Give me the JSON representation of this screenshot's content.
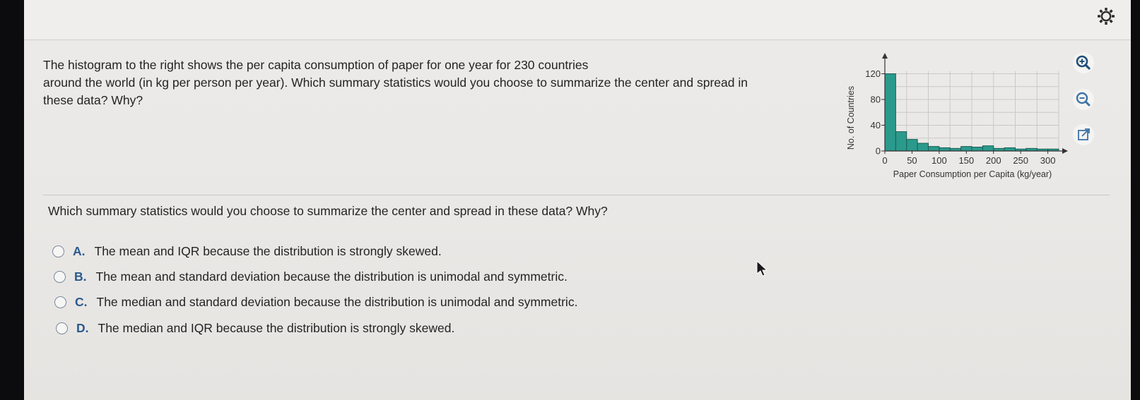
{
  "question": {
    "lines": [
      "The histogram to the right shows the per capita consumption of paper for one year for 230 countries",
      "around the world (in kg per person per year). Which summary statistics would you choose to summarize the center and spread in",
      "these data? Why?"
    ]
  },
  "prompt": "Which summary statistics would you choose to summarize the center and spread in these data? Why?",
  "options": [
    {
      "letter": "A.",
      "text": "The mean and IQR because the distribution is strongly skewed."
    },
    {
      "letter": "B.",
      "text": "The mean and standard deviation because the distribution is unimodal and symmetric."
    },
    {
      "letter": "C.",
      "text": "The median and standard deviation because the distribution is unimodal and symmetric."
    },
    {
      "letter": "D.",
      "text": "The median and IQR because the distribution is strongly skewed."
    }
  ],
  "tools": [
    "zoom-in-icon",
    "zoom-out-icon",
    "open-new-window-icon"
  ],
  "colors": {
    "bar_fill": "#2a9a8c",
    "bar_stroke": "#1c5e57",
    "accent": "#2a5a8e"
  },
  "chart_data": {
    "type": "bar",
    "xlabel": "Paper Consumption per Capita (kg/year)",
    "ylabel": "No. of Countries",
    "x_ticks": [
      "0",
      "50",
      "100",
      "150",
      "200",
      "250",
      "300"
    ],
    "y_ticks": [
      "0",
      "40",
      "80",
      "120"
    ],
    "xlim": [
      0,
      320
    ],
    "ylim": [
      0,
      125
    ],
    "bin_width": 20,
    "bins_start": [
      0,
      20,
      40,
      60,
      80,
      100,
      120,
      140,
      160,
      180,
      200,
      220,
      240,
      260,
      280,
      300
    ],
    "values": [
      120,
      30,
      18,
      12,
      7,
      5,
      4,
      7,
      6,
      8,
      4,
      5,
      3,
      4,
      3,
      3
    ],
    "grid": true
  }
}
